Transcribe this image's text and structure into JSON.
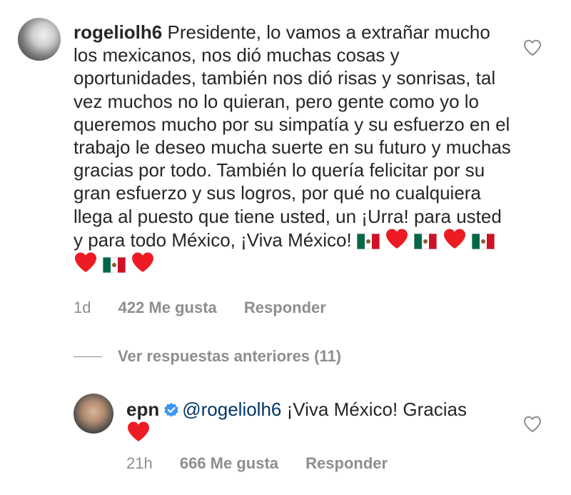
{
  "comment_1": {
    "username": "rogeliolh6",
    "text": "Presidente, lo vamos a extrañar mucho los mexicanos, nos dió muchas cosas y oportunidades, también nos dió risas y sonrisas, tal vez muchos no lo quieran, pero gente como yo lo queremos mucho por su simpatía y su esfuerzo en el trabajo le deseo mucha suerte en su futuro y muchas gracias por todo. También lo quería felicitar por su gran esfuerzo y sus logros, por qué no cualquiera llega al puesto que tiene usted, un ¡Urra! para usted y para todo México, ¡Viva México!",
    "emojis": [
      "mexico-flag",
      "red-heart",
      "mexico-flag",
      "red-heart",
      "mexico-flag",
      "red-heart",
      "mexico-flag",
      "red-heart"
    ],
    "time": "1d",
    "likes": "422 Me gusta",
    "reply_label": "Responder"
  },
  "view_replies": {
    "label": "Ver respuestas anteriores (11)"
  },
  "comment_2": {
    "username": "epn",
    "mention": "@rogeliolh6",
    "text": " ¡Viva México! Gracias",
    "emojis": [
      "red-heart"
    ],
    "time": "21h",
    "likes": "666 Me gusta",
    "reply_label": "Responder"
  },
  "colors": {
    "text": "#262626",
    "muted": "#8e8e8e",
    "mention": "#003569",
    "verified": "#3897f0",
    "heart": "#ed1c24"
  },
  "icons": {
    "like": "heart-outline-icon",
    "verified": "verified-badge-icon"
  }
}
